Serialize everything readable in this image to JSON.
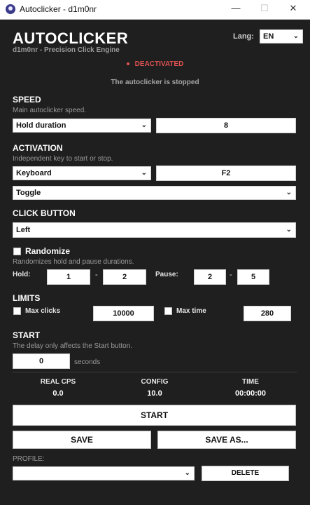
{
  "window": {
    "title": "Autoclicker - d1m0nr",
    "minimize": "—",
    "maximize": "☐",
    "close": "✕"
  },
  "header": {
    "brand": "AUTOCLICKER",
    "subtitle": "d1m0nr - Precision Click Engine",
    "lang_label": "Lang:",
    "lang_value": "EN"
  },
  "status": {
    "state": "DEACTIVATED",
    "message": "The autoclicker is stopped",
    "state_color": "#e05252"
  },
  "speed": {
    "title": "SPEED",
    "desc": "Main autoclicker speed.",
    "mode": "Hold duration",
    "value": "8"
  },
  "activation": {
    "title": "ACTIVATION",
    "desc": "Independent key to start or stop.",
    "device": "Keyboard",
    "key": "F2",
    "mode": "Toggle"
  },
  "click_button": {
    "title": "CLICK BUTTON",
    "value": "Left"
  },
  "randomize": {
    "label": "Randomize",
    "desc": "Randomizes hold and pause durations.",
    "hold_label": "Hold:",
    "hold_min": "1",
    "hold_max": "2",
    "pause_label": "Pause:",
    "pause_min": "2",
    "pause_max": "5",
    "sep": "-"
  },
  "limits": {
    "title": "LIMITS",
    "max_clicks_label": "Max clicks",
    "max_clicks_value": "10000",
    "max_time_label": "Max time",
    "max_time_value": "280"
  },
  "start_section": {
    "title": "START",
    "desc": "The delay only affects the Start button.",
    "delay": "0",
    "unit": "seconds"
  },
  "stats": {
    "real_cps_label": "REAL CPS",
    "real_cps": "0.0",
    "config_label": "CONFIG",
    "config": "10.0",
    "time_label": "TIME",
    "time": "00:00:00"
  },
  "buttons": {
    "start": "START",
    "save": "SAVE",
    "save_as": "SAVE AS...",
    "delete": "DELETE"
  },
  "profile": {
    "label": "PROFILE:",
    "value": ""
  },
  "icons": {
    "chevron": "chevron-down-icon",
    "app": "app-icon",
    "dot": "status-dot-icon"
  }
}
